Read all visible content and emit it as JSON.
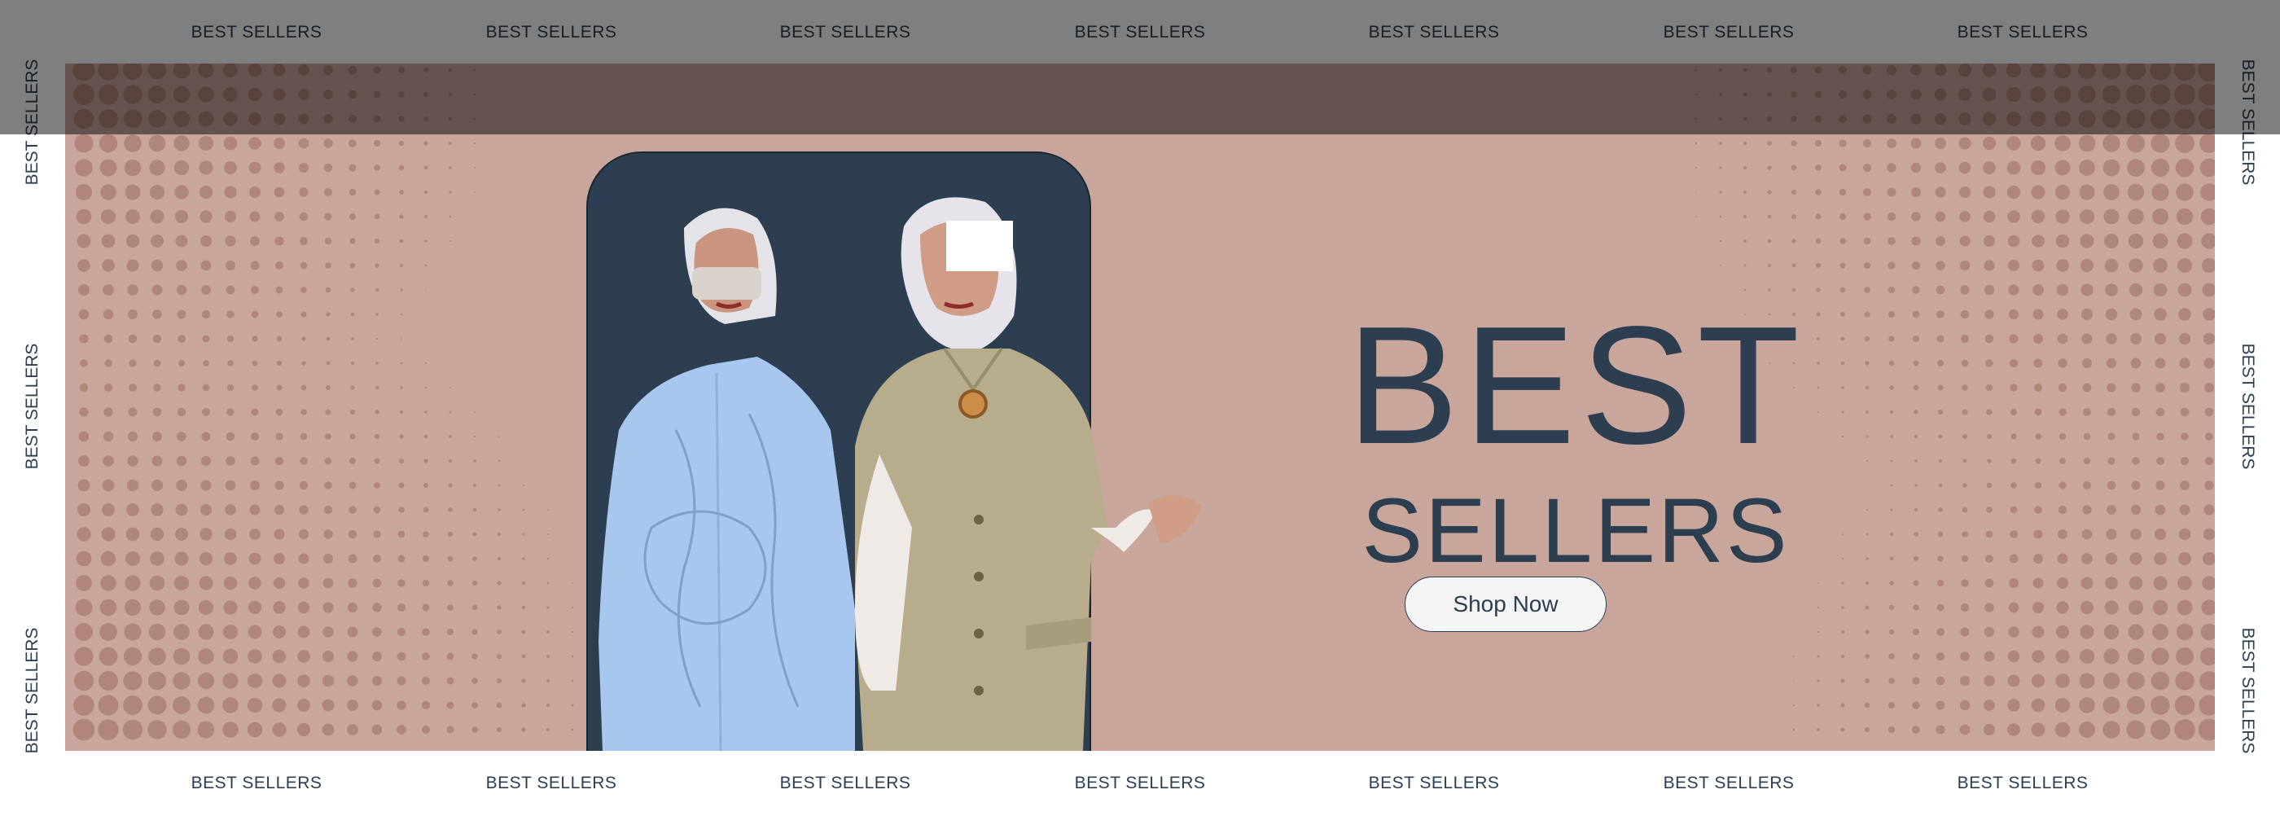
{
  "marquee": {
    "top": [
      "BEST SELLERS",
      "BEST SELLERS",
      "BEST SELLERS",
      "BEST SELLERS",
      "BEST SELLERS",
      "BEST SELLERS",
      "BEST SELLERS"
    ],
    "bottom": [
      "BEST SELLERS",
      "BEST SELLERS",
      "BEST SELLERS",
      "BEST SELLERS",
      "BEST SELLERS",
      "BEST SELLERS",
      "BEST SELLERS"
    ],
    "left": [
      "BEST SELLERS",
      "BEST SELLERS",
      "BEST SELLERS"
    ],
    "right": [
      "BEST SELLERS",
      "BEST SELLERS",
      "BEST SELLERS"
    ]
  },
  "banner": {
    "headline_line1": "BEST",
    "headline_line2": "SELLERS",
    "cta_label": "Shop Now",
    "colors": {
      "background": "#c8a69c",
      "panel": "#2c3e50",
      "text": "#2c3e50",
      "dots": "#a87b70"
    }
  }
}
